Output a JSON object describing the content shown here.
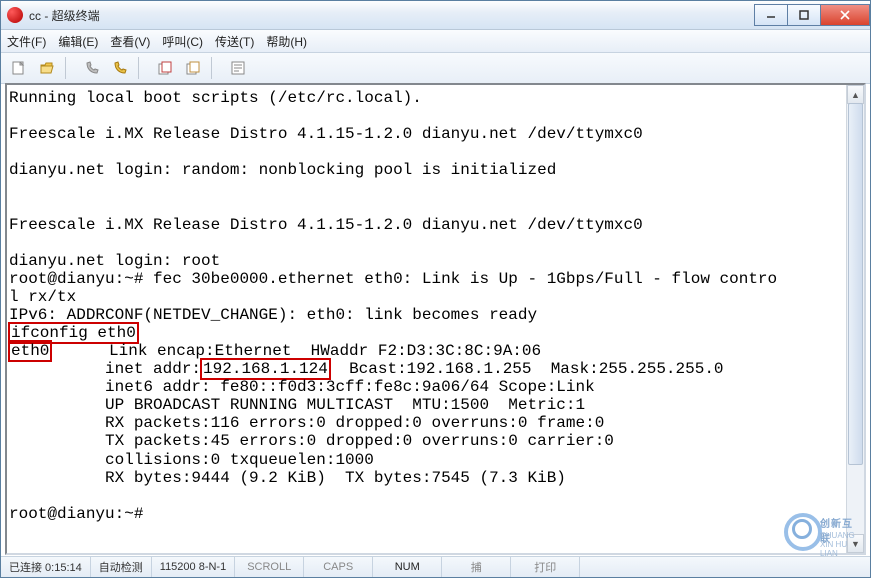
{
  "window": {
    "title": "cc - 超级终端"
  },
  "menu": {
    "file": "文件(F)",
    "edit": "编辑(E)",
    "view": "查看(V)",
    "call": "呼叫(C)",
    "trans": "传送(T)",
    "help": "帮助(H)"
  },
  "terminal": {
    "l1": "Running local boot scripts (/etc/rc.local).",
    "l2": "",
    "l3": "Freescale i.MX Release Distro 4.1.15-1.2.0 dianyu.net /dev/ttymxc0",
    "l4": "",
    "l5": "dianyu.net login: random: nonblocking pool is initialized",
    "l6": "",
    "l7": "",
    "l8": "Freescale i.MX Release Distro 4.1.15-1.2.0 dianyu.net /dev/ttymxc0",
    "l9": "",
    "l10": "dianyu.net login: root",
    "l11": "root@dianyu:~# fec 30be0000.ethernet eth0: Link is Up - 1Gbps/Full - flow contro",
    "l12": "l rx/tx",
    "l13_a": "IPv6: ADDRCONF",
    "l13_b": "(NETDEV_CHANGE): eth0: link becomes ready",
    "l14": "ifconfig eth0",
    "l15_a": "eth0",
    "l15_b": "      Link encap:Ethernet  HWaddr",
    "l15_c": " F2:D3:3C:8C:9A:06",
    "l16_a": "          inet addr:",
    "l16_b": "192.168.1.124",
    "l16_c": "  Bcast:192.168.1.255  Mask:255.255.255.0",
    "l17": "          inet6 addr: fe80::f0d3:3cff:fe8c:9a06/64 Scope:Link",
    "l18": "          UP BROADCAST RUNNING MULTICAST  MTU:1500  Metric:1",
    "l19": "          RX packets:116 errors:0 dropped:0 overruns:0 frame:0",
    "l20": "          TX packets:45 errors:0 dropped:0 overruns:0 carrier:0",
    "l21": "          collisions:0 txqueuelen:1000",
    "l22": "          RX bytes:9444 (9.2 KiB)  TX bytes:7545 (7.3 KiB)",
    "l23": "",
    "l24": "root@dianyu:~#"
  },
  "status": {
    "conn": "已连接 0:15:14",
    "detect": "自动检测",
    "baud": "115200 8-N-1",
    "scroll": "SCROLL",
    "caps": "CAPS",
    "num": "NUM",
    "cap2": "捕",
    "print": "打印"
  },
  "watermark": {
    "brand": "创新互联",
    "sub": "CHUANG XIN HU LIAN"
  }
}
